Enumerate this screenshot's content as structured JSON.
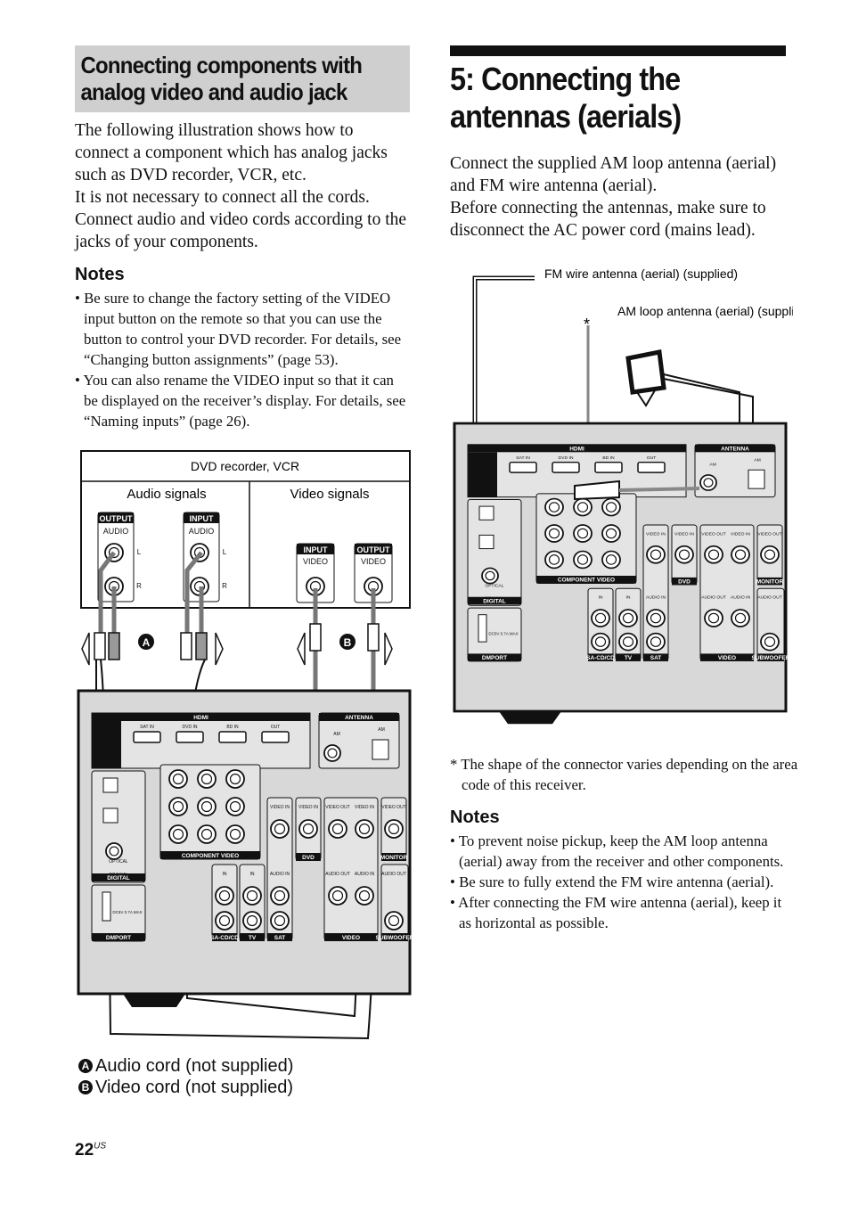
{
  "left": {
    "heading": "Connecting components with analog video and audio jack",
    "paragraphs": [
      "The following illustration shows how to connect a component which has analog jacks such as DVD recorder, VCR, etc.",
      "It is not necessary to connect all the cords. Connect audio and video cords according to the jacks of your components."
    ],
    "notes_title": "Notes",
    "notes": [
      "Be sure to change the factory setting of the VIDEO input button on the remote so that you can use the button to control your DVD recorder. For details, see “Changing button assignments” (page 53).",
      "You can also rename the VIDEO input so that it can be displayed on the receiver’s display. For details, see “Naming inputs” (page 26)."
    ],
    "diagram": {
      "device_title": "DVD recorder, VCR",
      "audio_signals": "Audio signals",
      "video_signals": "Video signals",
      "output": "OUTPUT",
      "input": "INPUT",
      "audio": "AUDIO",
      "video": "VIDEO",
      "l": "L",
      "r": "R",
      "marker_a": "A",
      "marker_b": "B"
    },
    "legend": [
      {
        "marker": "A",
        "text": "Audio cord (not supplied)"
      },
      {
        "marker": "B",
        "text": "Video cord (not supplied)"
      }
    ]
  },
  "receiver": {
    "hdmi": "HDMI",
    "antenna": "ANTENNA",
    "sat_in": "SAT IN",
    "dvd_in": "DVD IN",
    "bd_in": "BD IN",
    "out": "OUT",
    "connect_note": "CONNECT TO DIGITAL INPUT FOR AUDIO",
    "fm": "FM 75Ω COAXIAL",
    "am": "AM",
    "component_video": "COMPONENT VIDEO",
    "digital": "DIGITAL",
    "dmport": "DMPORT",
    "dvd": "DVD",
    "monitor": "MONITOR",
    "video": "VIDEO",
    "subwoofer": "SUBWOOFER",
    "sacd": "SA-CD/CD",
    "tv": "TV",
    "sat": "SAT",
    "optical": "OPTICAL",
    "coaxial": "COAXIAL",
    "bd_in_opt": "BD IN",
    "sat_in_opt": "SAT IN",
    "dvd_in_coax": "DVD IN",
    "y": "Y",
    "pb": "PB/CB",
    "pr": "PR/CR",
    "monitor_out": "MONITOR OUT",
    "video_in": "VIDEO IN",
    "video_out": "VIDEO OUT",
    "audio_in": "AUDIO IN",
    "audio_out": "AUDIO OUT",
    "in": "IN",
    "dc": "DC5V 0.7A MAX"
  },
  "right": {
    "title": "5: Connecting the antennas (aerials)",
    "paragraphs": [
      "Connect the supplied AM loop antenna (aerial) and FM wire antenna (aerial).",
      "Before connecting the antennas, make sure to disconnect the AC power cord (mains lead)."
    ],
    "fm_label": "FM wire antenna (aerial) (supplied)",
    "am_label": "AM loop antenna (aerial) (supplied)",
    "asterisk": "*",
    "footnote": "* The shape of the connector varies depending on the area code of this receiver.",
    "notes_title": "Notes",
    "notes": [
      "To prevent noise pickup, keep the AM loop antenna (aerial) away from the receiver and other components.",
      "Be sure to fully extend the FM wire antenna (aerial).",
      "After connecting the FM wire antenna (aerial), keep it as horizontal as possible."
    ]
  },
  "footer": {
    "page_number": "22",
    "page_suffix": "US"
  }
}
